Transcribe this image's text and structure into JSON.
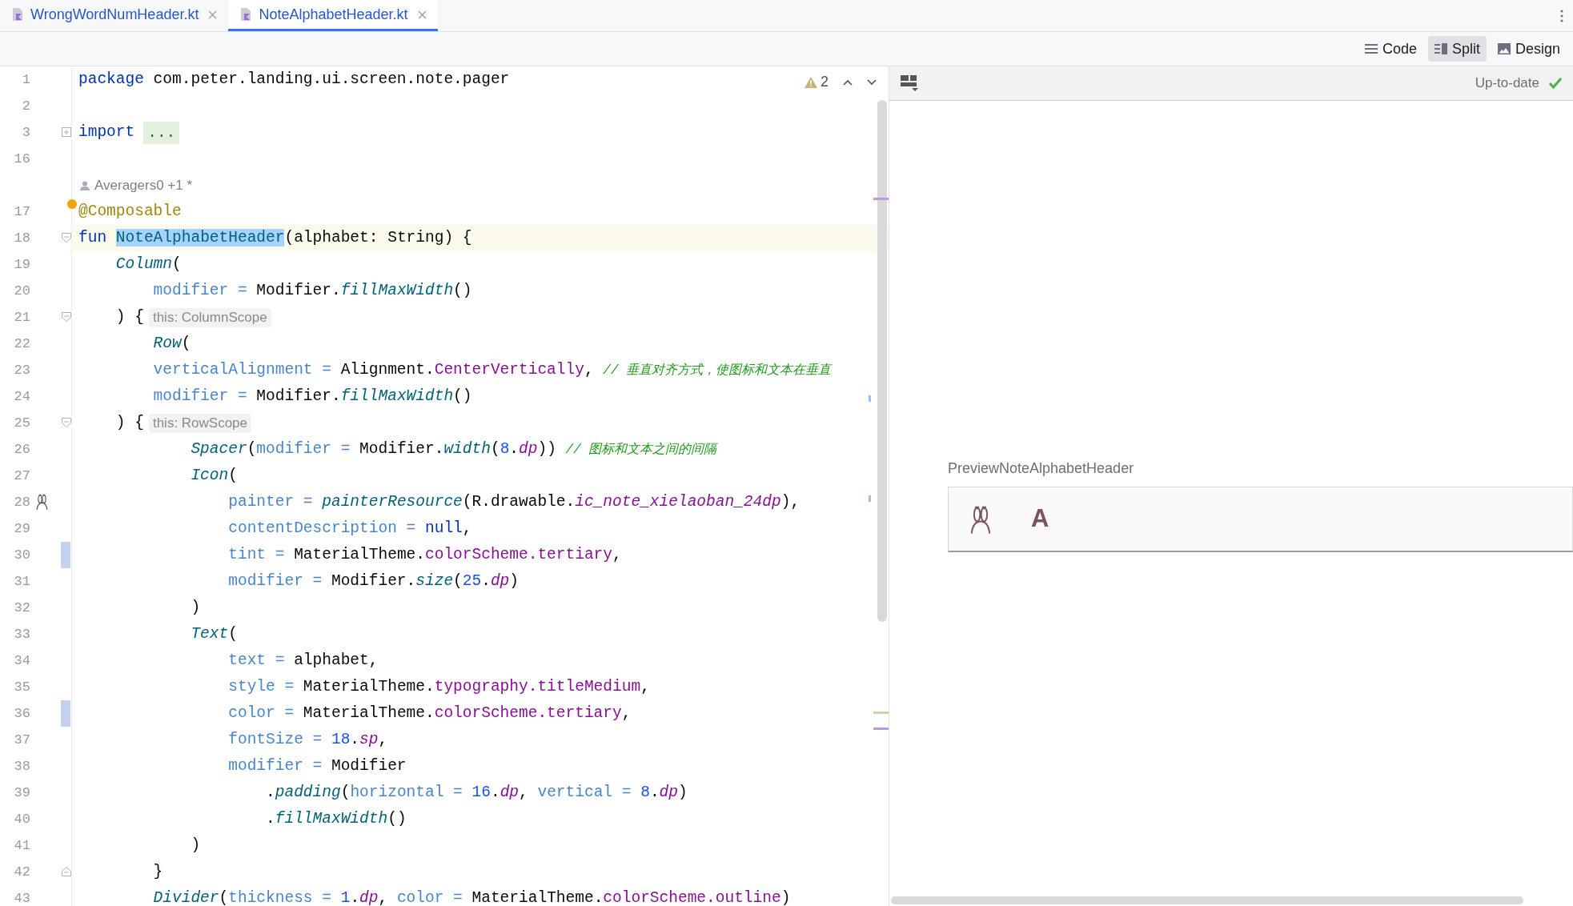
{
  "tabs": [
    {
      "label": "WrongWordNumHeader.kt",
      "selected": false
    },
    {
      "label": "NoteAlphabetHeader.kt",
      "selected": true
    }
  ],
  "view_modes": [
    {
      "label": "Code",
      "selected": false
    },
    {
      "label": "Split",
      "selected": true
    },
    {
      "label": "Design",
      "selected": false
    }
  ],
  "editor": {
    "warnings": "2",
    "lines": [
      {
        "kind": "code",
        "number": "1",
        "changed": false,
        "current": false,
        "segments": [
          {
            "kind": "kw",
            "text": "package"
          },
          {
            "kind": "pl",
            "text": " com.peter.landing.ui.screen.note.pager"
          }
        ]
      },
      {
        "kind": "code",
        "number": "2",
        "changed": false,
        "current": false
      },
      {
        "kind": "code",
        "number": "3",
        "changed": false,
        "current": false,
        "folded": true,
        "segments": [
          {
            "kind": "kw",
            "text": "import"
          },
          {
            "kind": "fold",
            "text": "..."
          }
        ]
      },
      {
        "kind": "code",
        "number": "16",
        "changed": false,
        "current": false
      },
      {
        "kind": "author",
        "text": "Averagers0 +1 *"
      },
      {
        "kind": "code",
        "number": "17",
        "changed": false,
        "current": false,
        "bulb": true,
        "segments": [
          {
            "kind": "ann",
            "text": "@Composable"
          }
        ]
      },
      {
        "kind": "code",
        "number": "18",
        "changed": false,
        "current": true,
        "folded": false,
        "segments": [
          {
            "kind": "kw",
            "text": "fun "
          },
          {
            "kind": "sel",
            "text": "NoteAlphabetHeader"
          },
          {
            "kind": "pl",
            "text": "(alphabet: String) {"
          }
        ]
      },
      {
        "kind": "code",
        "number": "19",
        "changed": false,
        "current": false,
        "segments": [
          {
            "kind": "call",
            "text": "    Column"
          },
          {
            "kind": "pl",
            "text": "("
          }
        ]
      },
      {
        "kind": "code",
        "number": "20",
        "changed": false,
        "current": false,
        "segments": [
          {
            "kind": "prm",
            "text": "        modifier ="
          },
          {
            "kind": "pl",
            "text": " Modifier."
          },
          {
            "kind": "call",
            "text": "fillMaxWidth"
          },
          {
            "kind": "pl",
            "text": "()"
          }
        ]
      },
      {
        "kind": "code",
        "number": "21",
        "changed": false,
        "current": false,
        "folded": false,
        "segments": [
          {
            "kind": "pl",
            "text": "    ) {"
          },
          {
            "kind": "hint",
            "text": "this: ColumnScope"
          }
        ]
      },
      {
        "kind": "code",
        "number": "22",
        "changed": false,
        "current": false,
        "segments": [
          {
            "kind": "call",
            "text": "        Row"
          },
          {
            "kind": "pl",
            "text": "("
          }
        ]
      },
      {
        "kind": "code",
        "number": "23",
        "changed": false,
        "current": false,
        "segments": [
          {
            "kind": "prm",
            "text": "        verticalAlignment ="
          },
          {
            "kind": "pl",
            "text": " Alignment."
          },
          {
            "kind": "prop",
            "text": "CenterVertically"
          },
          {
            "kind": "pl",
            "text": ", "
          },
          {
            "kind": "cmt",
            "text": "// 垂直对齐方式，使图标和文本在垂直"
          }
        ]
      },
      {
        "kind": "code",
        "number": "24",
        "changed": false,
        "current": false,
        "segments": [
          {
            "kind": "prm",
            "text": "        modifier ="
          },
          {
            "kind": "pl",
            "text": " Modifier."
          },
          {
            "kind": "call",
            "text": "fillMaxWidth"
          },
          {
            "kind": "pl",
            "text": "()"
          }
        ]
      },
      {
        "kind": "code",
        "number": "25",
        "changed": false,
        "current": false,
        "folded": false,
        "segments": [
          {
            "kind": "pl",
            "text": "    ) {"
          },
          {
            "kind": "hint",
            "text": "this: RowScope"
          }
        ]
      },
      {
        "kind": "code",
        "number": "26",
        "changed": false,
        "current": false,
        "segments": [
          {
            "kind": "call",
            "text": "            Spacer"
          },
          {
            "kind": "pl",
            "text": "("
          },
          {
            "kind": "prm",
            "text": "modifier ="
          },
          {
            "kind": "pl",
            "text": " Modifier."
          },
          {
            "kind": "call",
            "text": "width"
          },
          {
            "kind": "pl",
            "text": "("
          },
          {
            "kind": "num",
            "text": "8"
          },
          {
            "kind": "pl",
            "text": "."
          },
          {
            "kind": "propi",
            "text": "dp"
          },
          {
            "kind": "pl",
            "text": ")) "
          },
          {
            "kind": "cmt",
            "text": "// 图标和文本之间的间隔"
          }
        ]
      },
      {
        "kind": "code",
        "number": "27",
        "changed": false,
        "current": false,
        "segments": [
          {
            "kind": "call",
            "text": "            Icon"
          },
          {
            "kind": "pl",
            "text": "("
          }
        ]
      },
      {
        "kind": "code",
        "number": "28",
        "changed": false,
        "current": false,
        "gutter_icon": true,
        "segments": [
          {
            "kind": "prm",
            "text": "                painter ="
          },
          {
            "kind": "call",
            "text": " painterResource"
          },
          {
            "kind": "pl",
            "text": "(R.drawable."
          },
          {
            "kind": "propi",
            "text": "ic_note_xielaoban_24dp"
          },
          {
            "kind": "pl",
            "text": "),"
          }
        ]
      },
      {
        "kind": "code",
        "number": "29",
        "changed": false,
        "current": false,
        "segments": [
          {
            "kind": "prm",
            "text": "                contentDescription ="
          },
          {
            "kind": "kw",
            "text": " null"
          },
          {
            "kind": "pl",
            "text": ","
          }
        ]
      },
      {
        "kind": "code",
        "number": "30",
        "changed": true,
        "current": false,
        "segments": [
          {
            "kind": "prm",
            "text": "                tint ="
          },
          {
            "kind": "pl",
            "text": " MaterialTheme."
          },
          {
            "kind": "prop",
            "text": "colorScheme.tertiary"
          },
          {
            "kind": "pl",
            "text": ","
          }
        ]
      },
      {
        "kind": "code",
        "number": "31",
        "changed": false,
        "current": false,
        "segments": [
          {
            "kind": "prm",
            "text": "                modifier ="
          },
          {
            "kind": "pl",
            "text": " Modifier."
          },
          {
            "kind": "call",
            "text": "size"
          },
          {
            "kind": "pl",
            "text": "("
          },
          {
            "kind": "num",
            "text": "25"
          },
          {
            "kind": "pl",
            "text": "."
          },
          {
            "kind": "propi",
            "text": "dp"
          },
          {
            "kind": "pl",
            "text": ")"
          }
        ]
      },
      {
        "kind": "code",
        "number": "32",
        "changed": false,
        "current": false,
        "segments": [
          {
            "kind": "pl",
            "text": "            )"
          }
        ]
      },
      {
        "kind": "code",
        "number": "33",
        "changed": false,
        "current": false,
        "segments": [
          {
            "kind": "call",
            "text": "            Text"
          },
          {
            "kind": "pl",
            "text": "("
          }
        ]
      },
      {
        "kind": "code",
        "number": "34",
        "changed": false,
        "current": false,
        "segments": [
          {
            "kind": "prm",
            "text": "                text ="
          },
          {
            "kind": "pl",
            "text": " alphabet,"
          }
        ]
      },
      {
        "kind": "code",
        "number": "35",
        "changed": false,
        "current": false,
        "segments": [
          {
            "kind": "prm",
            "text": "                style ="
          },
          {
            "kind": "pl",
            "text": " MaterialTheme."
          },
          {
            "kind": "prop",
            "text": "typography.titleMedium"
          },
          {
            "kind": "pl",
            "text": ","
          }
        ]
      },
      {
        "kind": "code",
        "number": "36",
        "changed": true,
        "current": false,
        "segments": [
          {
            "kind": "prm",
            "text": "                color ="
          },
          {
            "kind": "pl",
            "text": " MaterialTheme."
          },
          {
            "kind": "prop",
            "text": "colorScheme.tertiary"
          },
          {
            "kind": "pl",
            "text": ","
          }
        ]
      },
      {
        "kind": "code",
        "number": "37",
        "changed": false,
        "current": false,
        "segments": [
          {
            "kind": "prm",
            "text": "                fontSize ="
          },
          {
            "kind": "num",
            "text": " 18"
          },
          {
            "kind": "pl",
            "text": "."
          },
          {
            "kind": "propi",
            "text": "sp"
          },
          {
            "kind": "pl",
            "text": ","
          }
        ]
      },
      {
        "kind": "code",
        "number": "38",
        "changed": false,
        "current": false,
        "segments": [
          {
            "kind": "prm",
            "text": "                modifier ="
          },
          {
            "kind": "pl",
            "text": " Modifier"
          }
        ]
      },
      {
        "kind": "code",
        "number": "39",
        "changed": false,
        "current": false,
        "segments": [
          {
            "kind": "pl",
            "text": "                    ."
          },
          {
            "kind": "call",
            "text": "padding"
          },
          {
            "kind": "pl",
            "text": "("
          },
          {
            "kind": "prm",
            "text": "horizontal ="
          },
          {
            "kind": "num",
            "text": " 16"
          },
          {
            "kind": "pl",
            "text": "."
          },
          {
            "kind": "propi",
            "text": "dp"
          },
          {
            "kind": "pl",
            "text": ", "
          },
          {
            "kind": "prm",
            "text": "vertical ="
          },
          {
            "kind": "num",
            "text": " 8"
          },
          {
            "kind": "pl",
            "text": "."
          },
          {
            "kind": "propi",
            "text": "dp"
          },
          {
            "kind": "pl",
            "text": ")"
          }
        ]
      },
      {
        "kind": "code",
        "number": "40",
        "changed": false,
        "current": false,
        "segments": [
          {
            "kind": "pl",
            "text": "                    ."
          },
          {
            "kind": "call",
            "text": "fillMaxWidth"
          },
          {
            "kind": "pl",
            "text": "()"
          }
        ]
      },
      {
        "kind": "code",
        "number": "41",
        "changed": false,
        "current": false,
        "segments": [
          {
            "kind": "pl",
            "text": "            )"
          }
        ]
      },
      {
        "kind": "code",
        "number": "42",
        "changed": false,
        "current": false,
        "fold_end": true,
        "segments": [
          {
            "kind": "pl",
            "text": "        }"
          }
        ]
      },
      {
        "kind": "code",
        "number": "43",
        "changed": false,
        "current": false,
        "segments": [
          {
            "kind": "call",
            "text": "        Divider"
          },
          {
            "kind": "pl",
            "text": "("
          },
          {
            "kind": "prm",
            "text": "thickness ="
          },
          {
            "kind": "num",
            "text": " 1"
          },
          {
            "kind": "pl",
            "text": "."
          },
          {
            "kind": "propi",
            "text": "dp"
          },
          {
            "kind": "pl",
            "text": ", "
          },
          {
            "kind": "prm",
            "text": "color ="
          },
          {
            "kind": "pl",
            "text": " MaterialTheme."
          },
          {
            "kind": "prop",
            "text": "colorScheme.outline"
          },
          {
            "kind": "pl",
            "text": ")"
          }
        ]
      }
    ]
  },
  "preview": {
    "status": "Up-to-date",
    "title": "PreviewNoteAlphabetHeader",
    "letter": "A"
  }
}
